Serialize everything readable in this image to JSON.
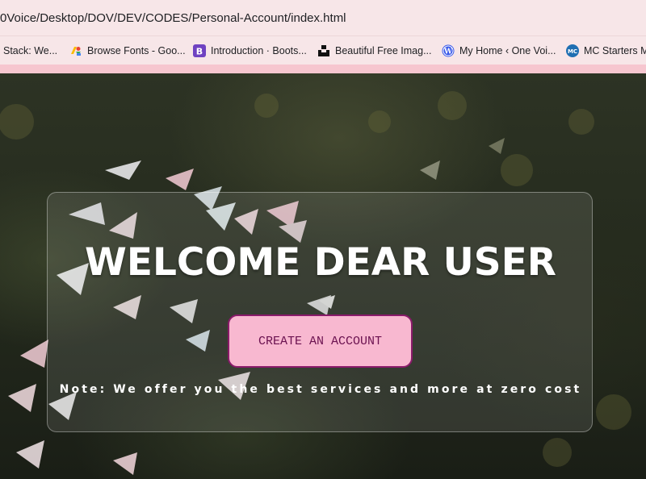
{
  "browser": {
    "url": "0Voice/Desktop/DOV/DEV/CODES/Personal-Account/index.html",
    "bookmarks": [
      {
        "label": "Stack: We...",
        "icon": "none"
      },
      {
        "label": "Browse Fonts - Goo...",
        "icon": "google-fonts-icon"
      },
      {
        "label": "Introduction · Boots...",
        "icon": "bootstrap-icon"
      },
      {
        "label": "Beautiful Free Imag...",
        "icon": "unsplash-icon"
      },
      {
        "label": "My Home ‹ One Voi...",
        "icon": "wordpress-icon"
      },
      {
        "label": "MC Starters Ma",
        "icon": "mc-icon"
      }
    ]
  },
  "page": {
    "title": "WELCOME DEAR USER",
    "cta_label": "CREATE AN ACCOUNT",
    "note": "Note: We offer you the best services and more at zero cost"
  },
  "colors": {
    "chrome": "#f7e6e8",
    "accent_pink": "#f8b8d0",
    "cta_border": "#8a1a6a",
    "cta_text": "#6b1250"
  }
}
